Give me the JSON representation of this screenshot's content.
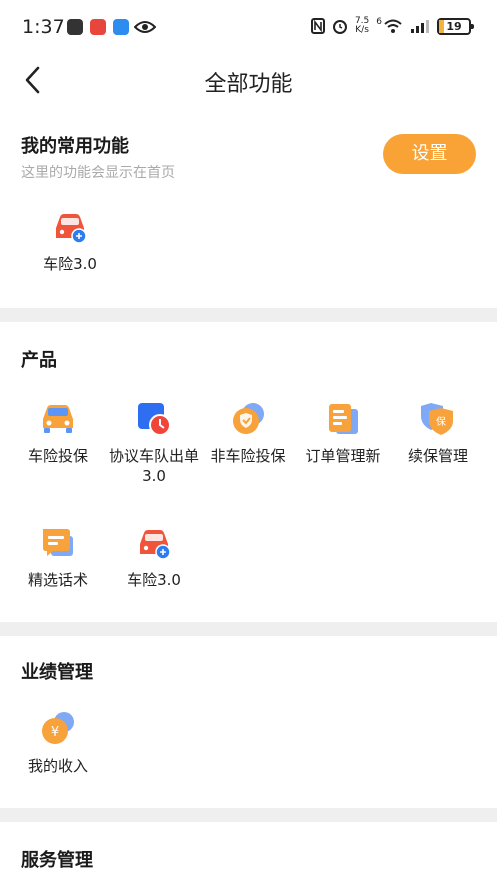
{
  "status_bar": {
    "time": "1:37",
    "speed_value": "7.5",
    "speed_unit": "K/s",
    "network": "6",
    "battery": "19"
  },
  "header": {
    "title": "全部功能"
  },
  "favorites": {
    "title": "我的常用功能",
    "subtitle": "这里的功能会显示在首页",
    "settings_label": "设置",
    "items": [
      {
        "label": "车险3.0",
        "icon": "car-insurance-icon"
      }
    ]
  },
  "products": {
    "title": "产品",
    "items": [
      {
        "label": "车险投保",
        "icon": "car-icon"
      },
      {
        "label": "协议车队出单3.0",
        "icon": "fleet-clock-icon"
      },
      {
        "label": "非车险投保",
        "icon": "shield-check-icon"
      },
      {
        "label": "订单管理新",
        "icon": "order-list-icon"
      },
      {
        "label": "续保管理",
        "icon": "renewal-shield-icon"
      },
      {
        "label": "精选话术",
        "icon": "chat-icon"
      },
      {
        "label": "车险3.0",
        "icon": "car-insurance-icon"
      }
    ]
  },
  "performance": {
    "title": "业绩管理",
    "items": [
      {
        "label": "我的收入",
        "icon": "income-icon"
      }
    ]
  },
  "service": {
    "title": "服务管理"
  }
}
